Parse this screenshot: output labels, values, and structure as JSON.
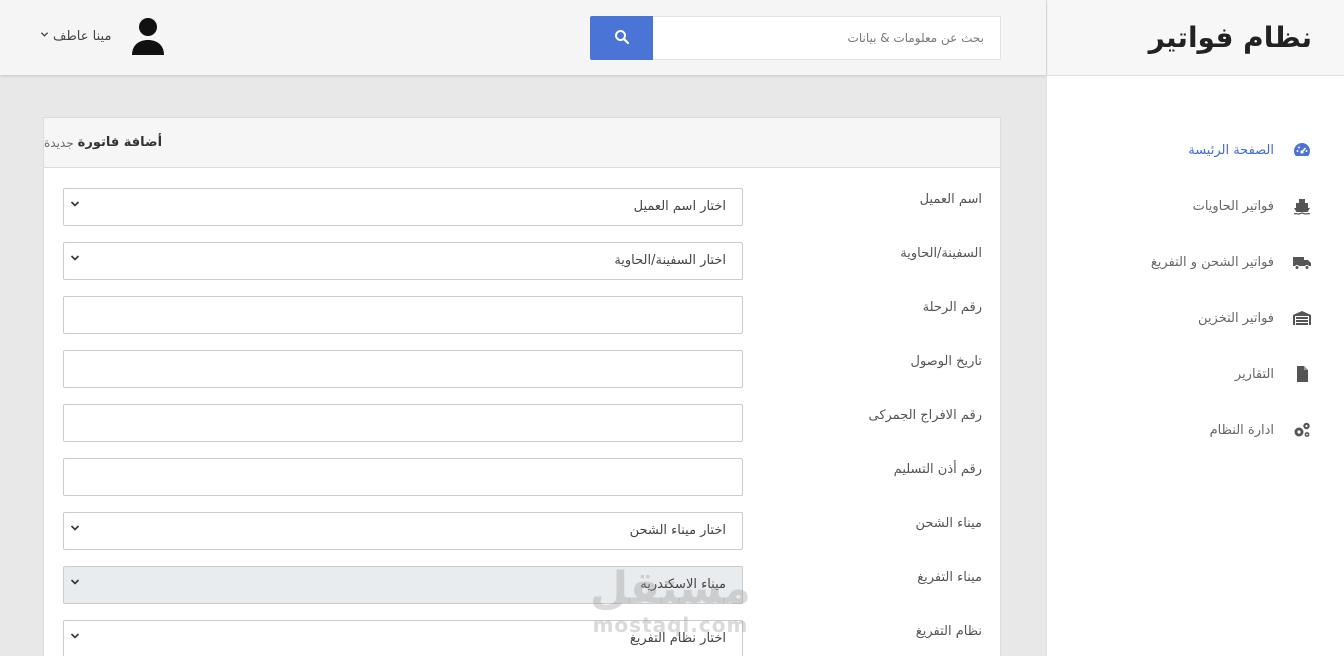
{
  "app": {
    "title": "نظام فواتير"
  },
  "colors": {
    "accent": "#4a74d6",
    "active_nav": "#3f6bd6"
  },
  "sidebar": {
    "items": [
      {
        "label": "الصفحة الرئيسة",
        "icon": "dashboard-icon",
        "active": true
      },
      {
        "label": "فواتير الحاويات",
        "icon": "ship-icon",
        "active": false
      },
      {
        "label": "فواتير الشحن و التفريغ",
        "icon": "truck-icon",
        "active": false
      },
      {
        "label": "فواتير التخزين",
        "icon": "warehouse-icon",
        "active": false
      },
      {
        "label": "التقارير",
        "icon": "file-icon",
        "active": false
      },
      {
        "label": "ادارة النظام",
        "icon": "gears-icon",
        "active": false
      }
    ]
  },
  "header": {
    "search_placeholder": "بحث عن معلومات & بيانات",
    "search_icon": "search-icon",
    "user_name": "مينا عاطف",
    "user_menu_icon": "chevron-down-icon",
    "avatar_icon": "user-icon"
  },
  "card": {
    "title_bold": "أضافة فاتورة",
    "title_light": "جديدة"
  },
  "form": {
    "fields": [
      {
        "label": "اسم العميل",
        "type": "select",
        "value": "اختار اسم العميل"
      },
      {
        "label": "السفينة/الحاوية",
        "type": "select",
        "value": "اختار السفينة/الحاوية"
      },
      {
        "label": "رقم الرحلة",
        "type": "text",
        "value": ""
      },
      {
        "label": "تاريخ الوصول",
        "type": "text",
        "value": ""
      },
      {
        "label": "رقم الافراج الجمركى",
        "type": "text",
        "value": ""
      },
      {
        "label": "رقم أذن التسليم",
        "type": "text",
        "value": ""
      },
      {
        "label": "ميناء الشحن",
        "type": "select",
        "value": "اختار ميناء الشحن"
      },
      {
        "label": "ميناء التفريغ",
        "type": "select",
        "value": "ميناء الاسكندريه",
        "disabled": true
      },
      {
        "label": "نظام التفريغ",
        "type": "select",
        "value": "اختار نظام التفريغ"
      }
    ]
  },
  "watermark": {
    "arabic": "مستقل",
    "latin": "mostaql.com"
  }
}
